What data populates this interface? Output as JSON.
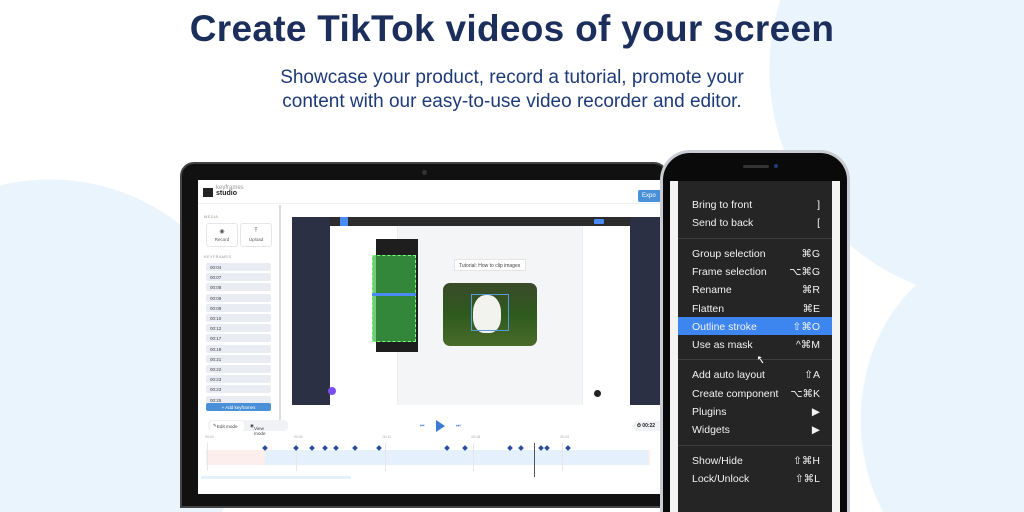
{
  "hero": {
    "title": "Create TikTok videos of your screen",
    "subtitle_line1": "Showcase your product, record a tutorial, promote your",
    "subtitle_line2": "content with our easy-to-use video recorder and editor."
  },
  "app": {
    "logo_top": "keyframes",
    "logo_bottom": "studio",
    "export_label": "Expo",
    "media_label": "MEDIA",
    "record_label": "Record",
    "upload_label": "Upload",
    "keyframes_label": "KEYFRAMES",
    "keyframes": [
      "00:04",
      "00:07",
      "00:08",
      "00:09",
      "00:09",
      "00:10",
      "00:12",
      "00:17",
      "00:18",
      "00:21",
      "00:22",
      "00:23",
      "00:23",
      "00:25"
    ],
    "add_keyframes": "+ Add keyframes",
    "video": {
      "tutorial_caption": "Tutorial: How to clip images"
    },
    "edit_mode": "Edit mode",
    "view_mode": "View mode",
    "time": "00:22",
    "timeline": {
      "ticks": [
        "00:00",
        "00:06",
        "00:12",
        "00:18",
        "00:24"
      ],
      "tick_seconds": [
        0,
        6,
        12,
        18,
        24
      ],
      "keyframe_seconds": [
        3.9,
        6,
        7.1,
        8,
        8.7,
        10,
        11.6,
        16.2,
        17.4,
        20.5,
        21.2,
        22.6,
        23,
        24.4
      ],
      "playhead_seconds": 22.1,
      "trim_start_seconds": 3.9
    }
  },
  "phone_menu": {
    "groups": [
      [
        {
          "label": "Bring to front",
          "key": "]"
        },
        {
          "label": "Send to back",
          "key": "["
        }
      ],
      [
        {
          "label": "Group selection",
          "key": "⌘G"
        },
        {
          "label": "Frame selection",
          "key": "⌥⌘G"
        },
        {
          "label": "Rename",
          "key": "⌘R"
        },
        {
          "label": "Flatten",
          "key": "⌘E"
        },
        {
          "label": "Outline stroke",
          "key": "⇧⌘O",
          "highlighted": true
        },
        {
          "label": "Use as mask",
          "key": "^⌘M"
        }
      ],
      [
        {
          "label": "Add auto layout",
          "key": "⇧A"
        },
        {
          "label": "Create component",
          "key": "⌥⌘K"
        },
        {
          "label": "Plugins",
          "key": "▶"
        },
        {
          "label": "Widgets",
          "key": "▶"
        }
      ],
      [
        {
          "label": "Show/Hide",
          "key": "⇧⌘H"
        },
        {
          "label": "Lock/Unlock",
          "key": "⇧⌘L"
        }
      ]
    ]
  },
  "colors": {
    "title": "#1c2e5c",
    "accent": "#3d86f0",
    "bg_blob": "#eaf4fd"
  }
}
